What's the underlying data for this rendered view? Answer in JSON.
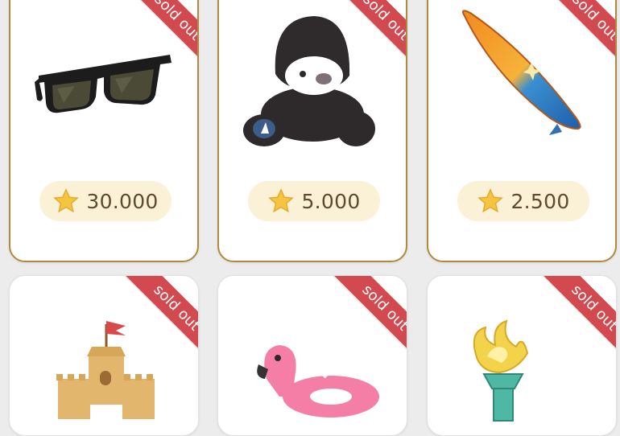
{
  "badge_label": "sold out",
  "gifts": [
    {
      "icon": "sunglasses-icon",
      "price": "30.000"
    },
    {
      "icon": "hooded-plush-icon",
      "price": "5.000"
    },
    {
      "icon": "surfboard-icon",
      "price": "2.500"
    },
    {
      "icon": "sandcastle-icon"
    },
    {
      "icon": "flamingo-float-icon"
    },
    {
      "icon": "torch-icon"
    }
  ],
  "colors": {
    "ribbon": "#d24a4f",
    "card_border": "#b08a3c",
    "price_pill": "#fbf1d6",
    "star": "#f5c542"
  }
}
